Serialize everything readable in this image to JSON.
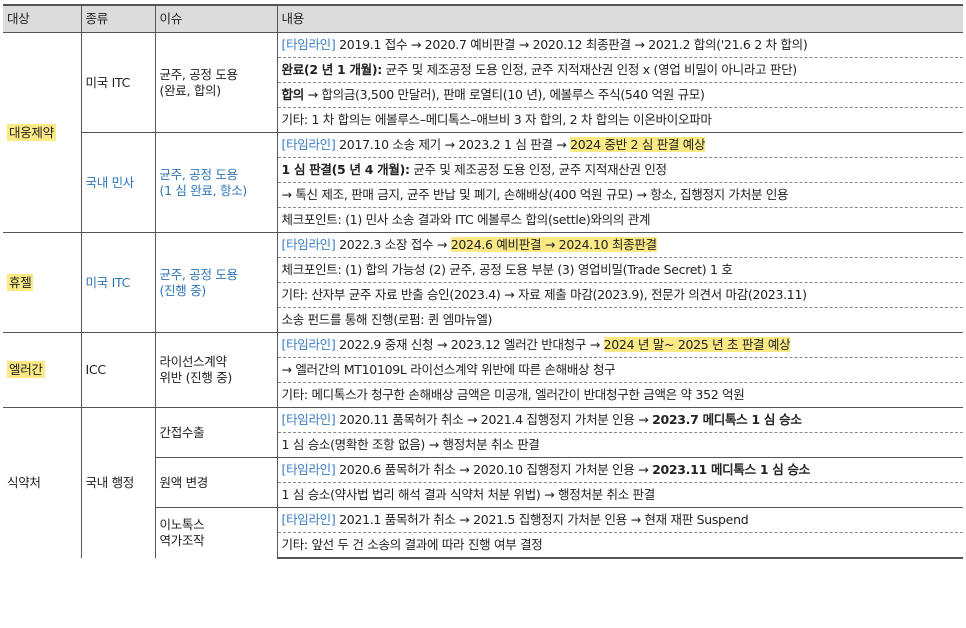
{
  "header": {
    "target": "대상",
    "type": "종류",
    "issue": "이슈",
    "content": "내용"
  },
  "g1": {
    "target": "대웅제약",
    "type1": "미국 ITC",
    "issue1a": "균주, 공정 도용",
    "issue1b": "(완료, 합의)",
    "r1_label": "[타임라인]",
    "r1_text": " 2019.1 접수 → 2020.7 예비판결 → 2020.12 최종판결 → 2021.2 합의('21.6 2 차 합의)",
    "r2_bold": "완료(2 년 1 개월):",
    "r2_text": " 균주 및 제조공정 도용 인정, 균주 지적재산권 인정 x (영업 비밀이 아니라고 판단)",
    "r3_bold": "합의",
    "r3_text": " → 합의금(3,500 만달러), 판매 로열티(10 년), 에볼루스 주식(540 억원 규모)",
    "r4_text": "기타: 1 차 합의는 에볼루스–메디톡스–애브비 3 자 합의, 2 차 합의는 이온바이오파마",
    "type2": "국내 민사",
    "issue2a": "균주, 공정 도용",
    "issue2b": "(1 심 완료, 항소)",
    "r5_label": "[타임라인]",
    "r5_text": " 2017.10 소송 제기 → 2023.2 1 심 판결 → ",
    "r5_hl": "2024 중반 2 심 판결 예상",
    "r6_bold": "1 심 판결(5 년 4 개월):",
    "r6_text": " 균주 및 제조공정 도용 인정, 균주 지적재산권 인정",
    "r7_text": "→ 톡신 제조, 판매 금지, 균주 반납 및 폐기, 손해배상(400 억원 규모) → 항소, 집행정지 가처분 인용",
    "r8_text": "체크포인트: (1) 민사 소송 결과와 ITC 에볼루스 합의(settle)와의의 관계"
  },
  "g2": {
    "target": "휴젤",
    "type": "미국 ITC",
    "issue_a": "균주, 공정 도용",
    "issue_b": "(진행 중)",
    "r1_label": "[타임라인]",
    "r1_text": " 2022.3 소장 접수 → ",
    "r1_hl": "2024.6 예비판결 → 2024.10 최종판결",
    "r2_text": "체크포인트: (1) 합의 가능성 (2) 균주, 공정 도용 부분 (3) 영업비밀(Trade Secret) 1 호",
    "r3_text": "기타: 산자부 균주 자료 반출 승인(2023.4) → 자료 제출 마감(2023.9), 전문가 의견서 마감(2023.11)",
    "r4_text": "소송 펀드를 통해 진행(로펌: 퀸 엠마뉴엘)"
  },
  "g3": {
    "target": "엘러간",
    "type": "ICC",
    "issue_a": "라이선스계약",
    "issue_b": "위반 (진행 중)",
    "r1_label": "[타임라인]",
    "r1_text": " 2022.9 중재 신청 → 2023.12 엘러간 반대청구 → ",
    "r1_hl": "2024 년 말~ 2025 년 초 판결 예상",
    "r2_text": "→ 엘러간의 MT10109L 라이선스계약 위반에 따른 손해배상 청구",
    "r3_text": "기타: 메디톡스가 청구한 손해배상 금액은 미공개, 엘러간이 반대청구한 금액은 약 352 억원"
  },
  "g4": {
    "target": "식약처",
    "type": "국내 행정",
    "issue1": "간접수출",
    "r1_label": "[타임라인]",
    "r1_text": " 2020.11 품목허가 취소 → 2021.4 집행정지 가처분 인용 → ",
    "r1_bold": "2023.7 메디톡스 1 심 승소",
    "r2_text": "1 심 승소(명확한 조항 없음) → 행정처분 취소 판결",
    "issue2": "원액 변경",
    "r3_label": "[타임라인]",
    "r3_text": " 2020.6 품목허가 취소 → 2020.10 집행정지 가처분 인용 → ",
    "r3_bold": "2023.11 메디톡스 1 심 승소",
    "r4_text": "1 심 승소(약사법 법리 해석 결과 식약처 처분 위법) → 행정처분 취소 판결",
    "issue3a": "이노톡스",
    "issue3b": "역가조작",
    "r5_label": "[타임라인]",
    "r5_text": " 2021.1 품목허가 취소 → 2021.5 집행정지 가처분 인용 → 현재 재판 Suspend",
    "r6_text": "기타: 앞선 두 건 소송의 결과에 따라 진행 여부 결정"
  },
  "colors": {
    "timeline": "#3a7cc4",
    "highlight": "#fbe986",
    "header_bg": "#dcdcdc",
    "blue_text": "#2e75b6"
  }
}
